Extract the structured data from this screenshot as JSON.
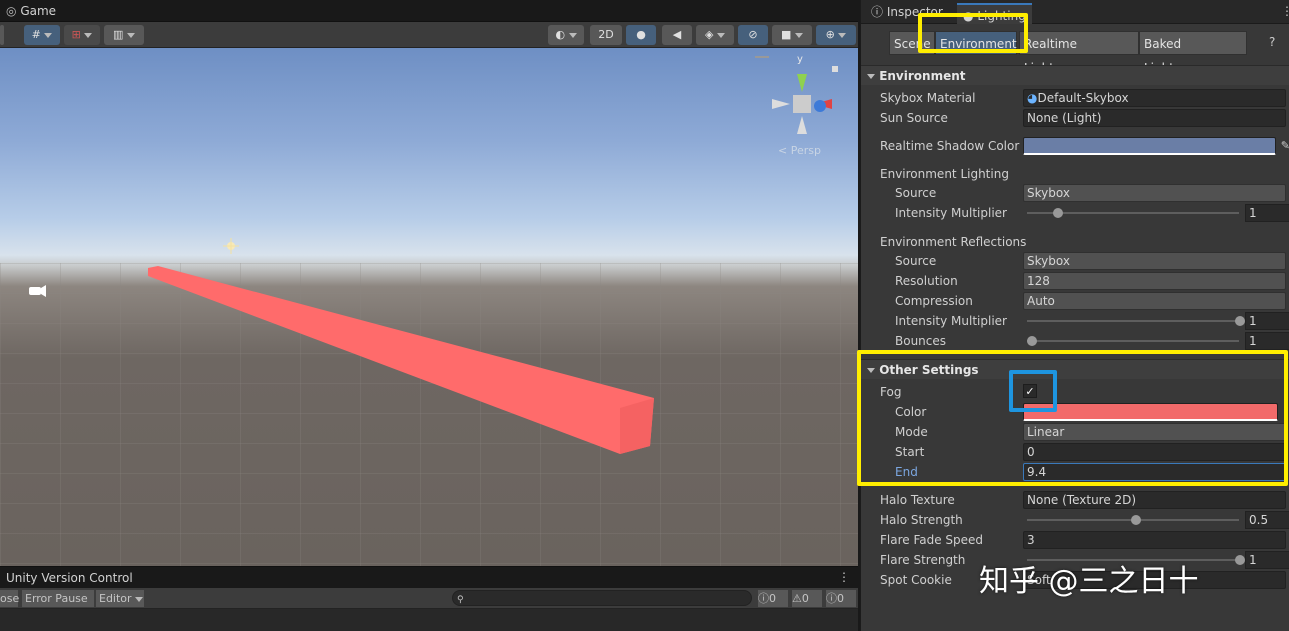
{
  "left": {
    "game_tab": "Game",
    "toolbar": {
      "mode_2d": "2D"
    },
    "console_tab": "Unity Version Control",
    "console_toolbar": {
      "clear_label": "ose",
      "error_pause": "Error Pause",
      "editor": "Editor",
      "log_count": "0",
      "warn_count": "0",
      "error_count": "0"
    },
    "gizmo": {
      "y_label": "y",
      "persp_label": "< Persp"
    }
  },
  "right": {
    "tabs": {
      "inspector": "Inspector",
      "lighting": "Lighting"
    },
    "lighting_tabs": [
      "Scene",
      "Environment",
      "Realtime Lightmaps",
      "Baked Lightmaps"
    ],
    "environment": {
      "header": "Environment",
      "skybox_material_label": "Skybox Material",
      "skybox_material_value": "Default-Skybox",
      "sun_source_label": "Sun Source",
      "sun_source_value": "None (Light)",
      "shadow_color_label": "Realtime Shadow Color",
      "shadow_color": "#6a7ea6",
      "env_lighting_label": "Environment Lighting",
      "lighting_source_label": "Source",
      "lighting_source_value": "Skybox",
      "lighting_intensity_label": "Intensity Multiplier",
      "lighting_intensity_value": "1",
      "lighting_intensity_fraction": 0.125,
      "env_reflections_label": "Environment Reflections",
      "refl_source_label": "Source",
      "refl_source_value": "Skybox",
      "resolution_label": "Resolution",
      "resolution_value": "128",
      "compression_label": "Compression",
      "compression_value": "Auto",
      "refl_intensity_label": "Intensity Multiplier",
      "refl_intensity_value": "1",
      "bounces_label": "Bounces",
      "bounces_value": "1"
    },
    "other": {
      "header": "Other Settings",
      "fog_label": "Fog",
      "fog_checked": true,
      "color_label": "Color",
      "fog_color": "#f26a6a",
      "mode_label": "Mode",
      "mode_value": "Linear",
      "start_label": "Start",
      "start_value": "0",
      "end_label": "End",
      "end_value": "9.4",
      "halo_texture_label": "Halo Texture",
      "halo_texture_value": "None (Texture 2D)",
      "halo_strength_label": "Halo Strength",
      "halo_strength_value": "0.5",
      "flare_fade_label": "Flare Fade Speed",
      "flare_fade_value": "3",
      "flare_strength_label": "Flare Strength",
      "flare_strength_value": "1",
      "spot_cookie_label": "Spot Cookie",
      "spot_cookie_value": "Soft"
    },
    "watermark": "知乎 @三之日十"
  },
  "colors": {
    "highlight_yellow": "#ffee00",
    "highlight_blue": "#1e95e0",
    "fog_strip": "#ff6b6b"
  }
}
